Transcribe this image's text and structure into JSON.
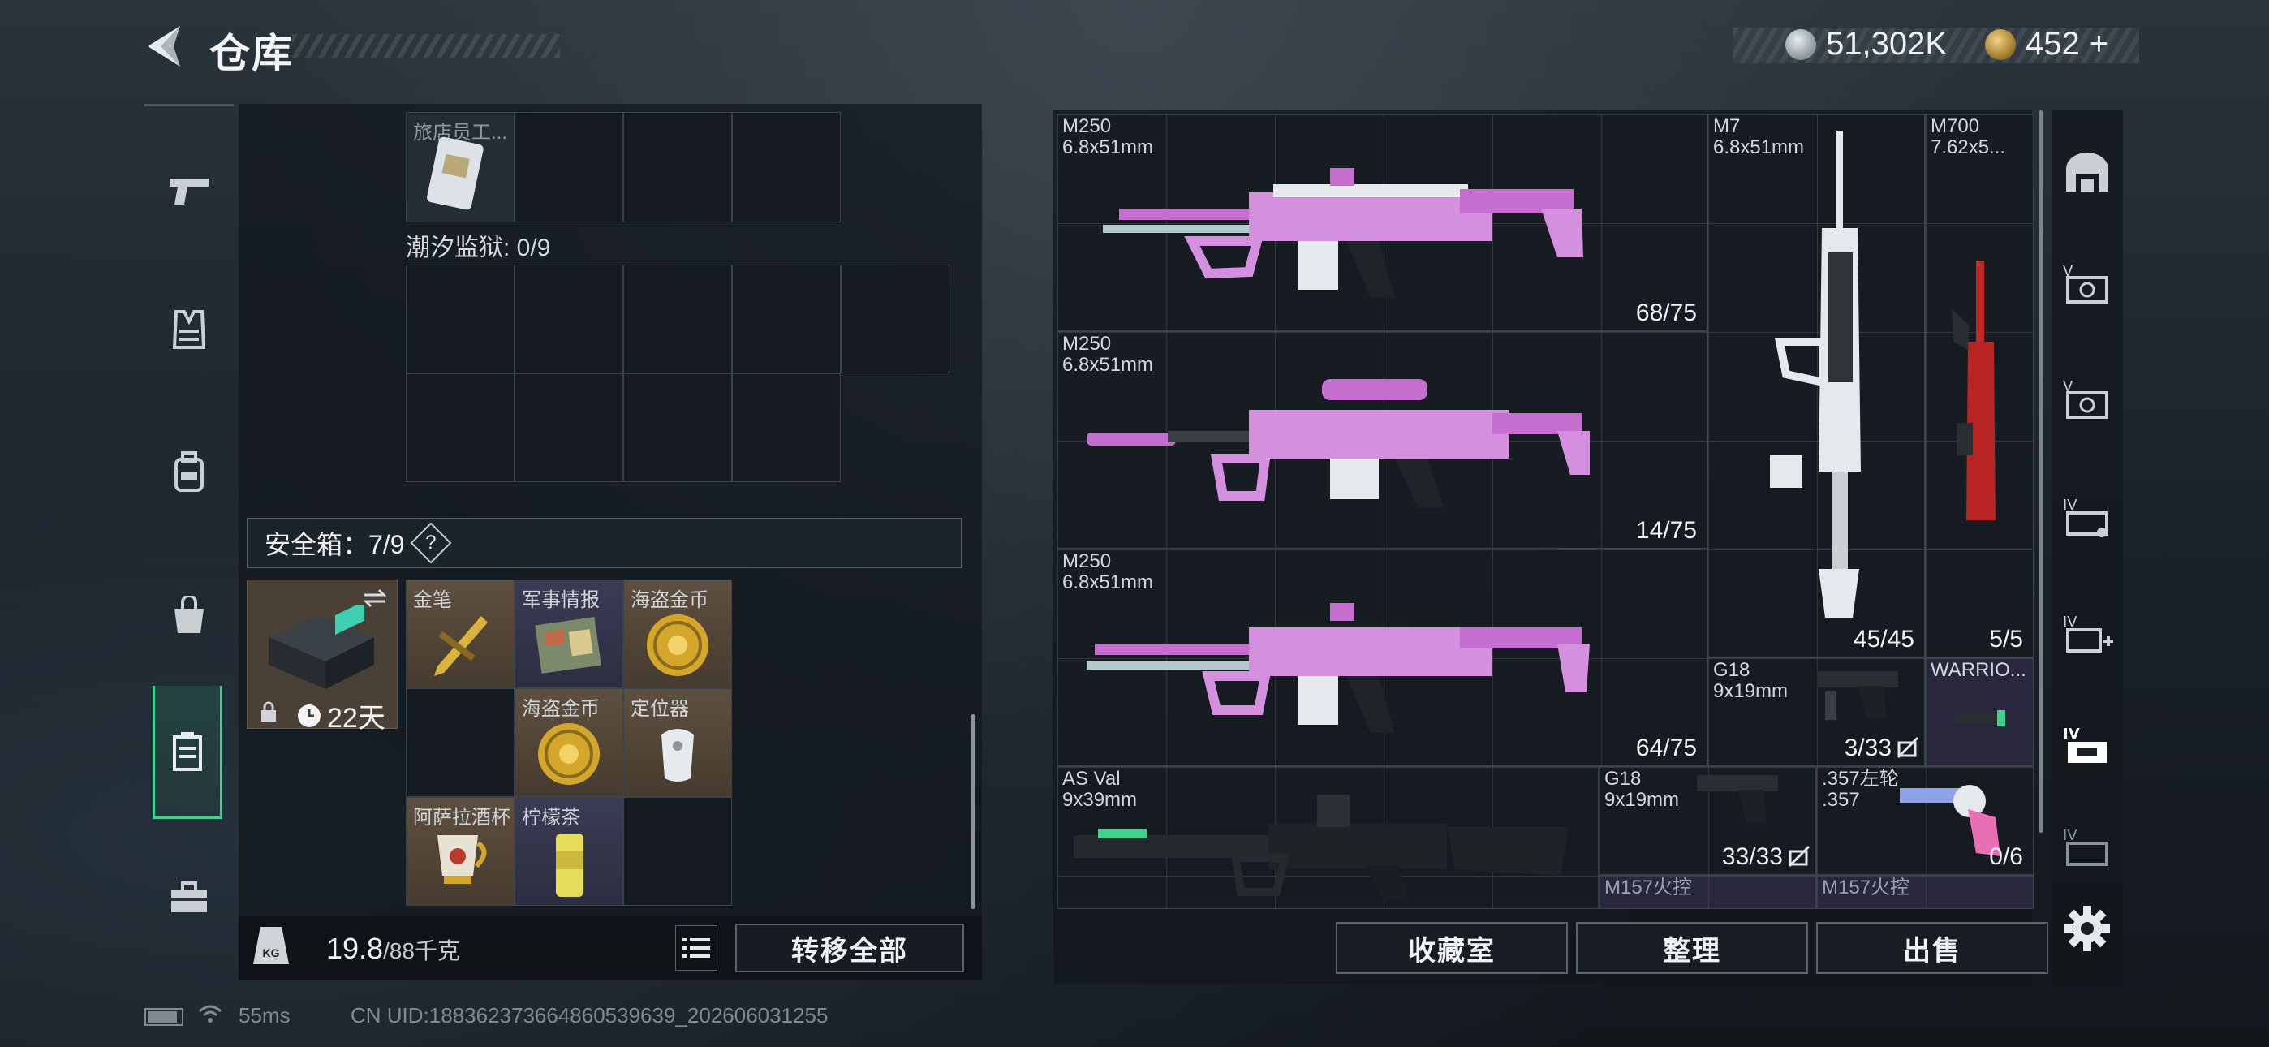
{
  "header": {
    "title": "仓库",
    "currencies": [
      {
        "icon": "silver-coin-icon",
        "value": "51,302K"
      },
      {
        "icon": "gold-coin-icon",
        "value": "452"
      }
    ],
    "add_symbol": "+"
  },
  "inventory": {
    "top_item": {
      "label": "旅店员工..."
    },
    "prison_label": "潮汐监狱: 0/9",
    "safe_label": "安全箱：7/9",
    "help": "?",
    "safebox": {
      "timer": "22天"
    },
    "items": [
      {
        "label": "金笔",
        "icon": "gold-pen-icon"
      },
      {
        "label": "军事情报",
        "icon": "intel-icon"
      },
      {
        "label": "海盗金币",
        "icon": "pirate-coin-icon"
      },
      {
        "label": "海盗金币",
        "icon": "pirate-coin-icon"
      },
      {
        "label": "定位器",
        "icon": "locator-icon"
      },
      {
        "label": "阿萨拉酒杯",
        "icon": "goblet-icon"
      },
      {
        "label": "柠檬茶",
        "icon": "lemon-tea-icon"
      }
    ],
    "weight_value": "19.8",
    "weight_max": "/88千克",
    "transfer_all": "转移全部"
  },
  "weapons": [
    {
      "name": "M250",
      "caliber": "6.8x51mm",
      "count": "68/75"
    },
    {
      "name": "M250",
      "caliber": "6.8x51mm",
      "count": "14/75"
    },
    {
      "name": "M250",
      "caliber": "6.8x51mm",
      "count": "64/75"
    },
    {
      "name": "M7",
      "caliber": "6.8x51mm",
      "count": "45/45"
    },
    {
      "name": "M700",
      "caliber": "7.62x5...",
      "count": "5/5"
    },
    {
      "name": "G18",
      "caliber": "9x19mm",
      "count": "3/33"
    },
    {
      "name": "WARRIO...",
      "caliber": "",
      "count": ""
    },
    {
      "name": "AS Val",
      "caliber": "9x39mm",
      "count": ""
    },
    {
      "name": "G18",
      "caliber": "9x19mm",
      "count": "33/33"
    },
    {
      "name": ".357左轮",
      "caliber": ".357",
      "count": "0/6"
    },
    {
      "name": "M157火控",
      "caliber": "",
      "count": ""
    },
    {
      "name": "M157火控",
      "caliber": "",
      "count": ""
    }
  ],
  "buttons": {
    "collection": "收藏室",
    "organize": "整理",
    "sell": "出售"
  },
  "right_rail": [
    "home-icon",
    "v-case-icon",
    "v-case-icon",
    "iv-case-icon",
    "iv-add-icon",
    "iv-selected-icon",
    "iv-case-icon"
  ],
  "status": {
    "ping": "55ms",
    "uid": "CN UID:18836237366486053963­9_202606031255"
  },
  "colors": {
    "accent_green": "#3fd18d",
    "weapon_pink": "#c46fcf",
    "gold": "#d9b33c"
  }
}
